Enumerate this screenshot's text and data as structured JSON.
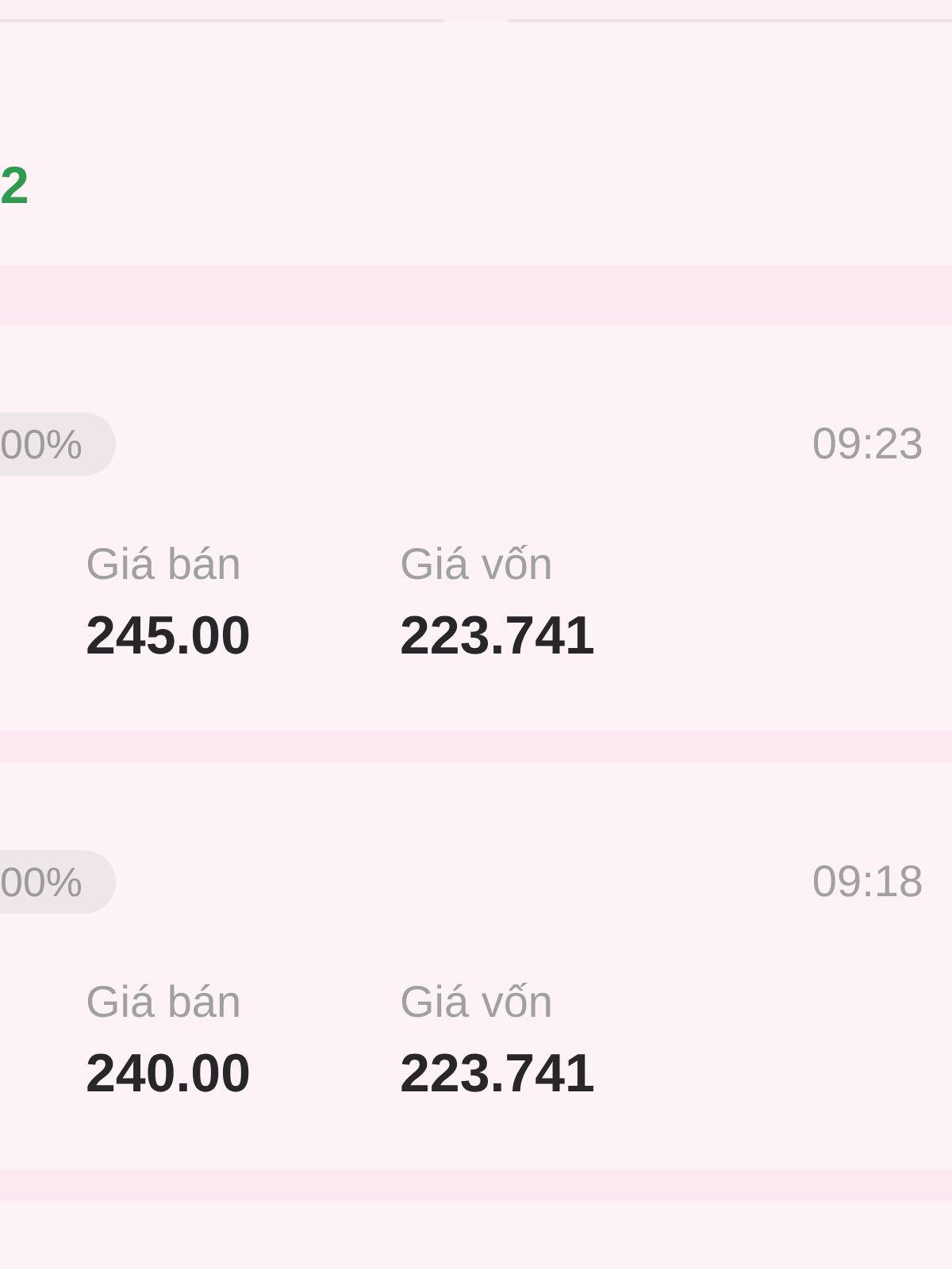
{
  "summary": {
    "value": "2"
  },
  "orders": [
    {
      "percent": "00%",
      "time": "09:23",
      "sale_price_label": "Giá bán",
      "sale_price": "245.00",
      "cost_price_label": "Giá vốn",
      "cost_price": "223.741"
    },
    {
      "percent": "00%",
      "time": "09:18",
      "sale_price_label": "Giá bán",
      "sale_price": "240.00",
      "cost_price_label": "Giá vốn",
      "cost_price": "223.741"
    }
  ]
}
